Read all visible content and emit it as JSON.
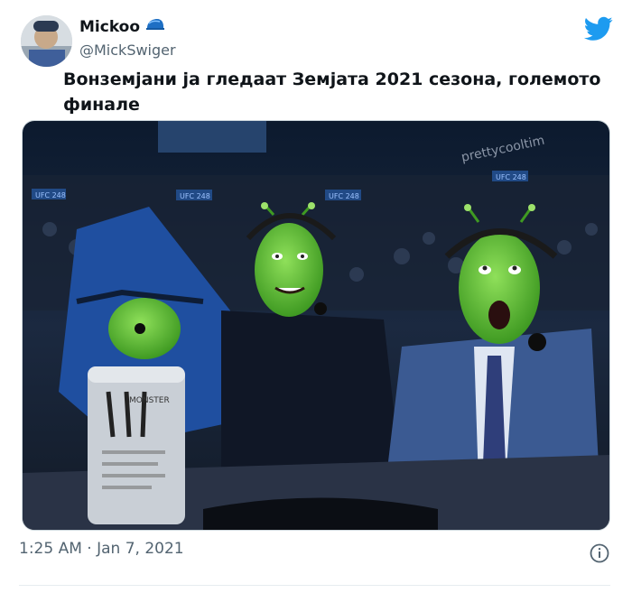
{
  "tweet": {
    "display_name": "Mickoo",
    "handle": "@MickSwiger",
    "text": "Вонземјани ја гледаат Земјата 2021 сезона, големото финале",
    "timestamp": "1:25 AM · Jan 7, 2021"
  },
  "media": {
    "watermark": "prettycooltim",
    "can_brand_text": "MONSTER",
    "banner_texts": [
      "UFC 248",
      "UFC 248",
      "UFC 248",
      "UFC 248"
    ]
  },
  "icons": {
    "brand": "twitter-bird-icon",
    "verified_style": "cap-icon",
    "info": "info-icon"
  },
  "colors": {
    "brand_blue": "#1d9bf0",
    "muted_text": "#536471",
    "alien_green": "#5fbf3a"
  }
}
